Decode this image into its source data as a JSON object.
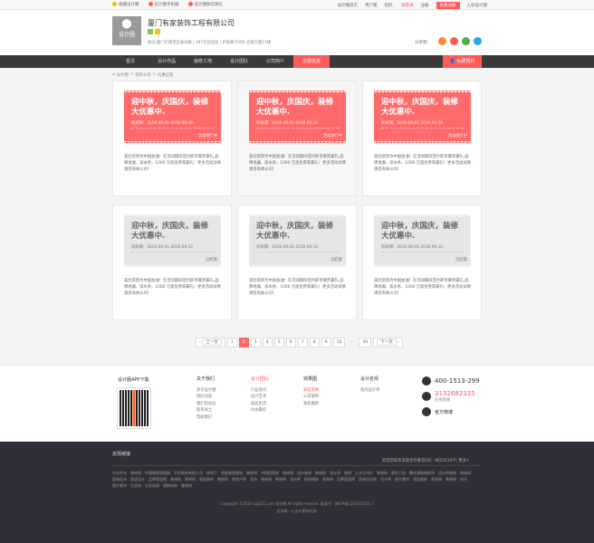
{
  "topbar": {
    "left": [
      "收藏设计圈",
      "设计圈手机端",
      "设计圈微信微信"
    ],
    "right": [
      "设计圈首页",
      "用户版",
      "您好,",
      "请登录",
      "注册",
      "免费注册",
      "入驻设计圈"
    ]
  },
  "header": {
    "logo_text": "设计圈",
    "company": "厦门有家装饰工程有限公司",
    "address": "地址:厦门市湖里区泰达路 | 397号创业园 | 护安路719号 名家大厦11楼",
    "share_label": "分享到:"
  },
  "nav": {
    "items": [
      "首页",
      "设计作品",
      "装修工地",
      "设计团队",
      "公司简介",
      "优惠信息"
    ],
    "cta": "免费预约"
  },
  "breadcrumb": [
    "设计圈",
    ">",
    "装修公司",
    ">",
    "优惠信息"
  ],
  "coupons": [
    {
      "title": "迎中秋，庆国庆，装修大优惠中.",
      "date": "有效期：2016.09.01-2016.09.10",
      "status": "活动进行中",
      "desc": "美杜装饰为中国加油！在活动期间签约即享尊贵豪礼,品牌地漏、扣水条、1000 元现金券等豪礼！更多活动详情请咨询本公司！"
    },
    {
      "title": "迎中秋，庆国庆，装修大优惠中.",
      "date": "有效期：2016.09.01-2016.09.10",
      "status": "活动进行中",
      "desc": "美杜装饰为中国加油！在活动期间签约即享尊贵豪礼,品牌地漏、扣水条、1000 元现金券等豪礼！更多活动详情请咨询本公司！"
    },
    {
      "title": "迎中秋，庆国庆，装修大优惠中.",
      "date": "有效期：2016.09.01-2016.09.10",
      "status": "活动进行中",
      "desc": "美杜装饰为中国加油！在活动期间签约即享尊贵豪礼,品牌地漏、扣水条、1000 元现金券等豪礼！更多活动详情请咨询本公司！"
    },
    {
      "title": "迎中秋，庆国庆，装修大优惠中.",
      "date": "有效期：2016.09.01-2016.09.10",
      "status": "已结束",
      "desc": "美杜装饰为中国加油！在活动期间签约即享尊贵豪礼,品牌地漏、扣水条、1000 元现金券等豪礼！更多活动详情请咨询本公司！"
    },
    {
      "title": "迎中秋，庆国庆，装修大优惠中.",
      "date": "有效期：2016.09.01-2016.09.10",
      "status": "已结束",
      "desc": "美杜装饰为中国加油！在活动期间签约即享尊贵豪礼,品牌地漏、扣水条、1000 元现金券等豪礼！更多活动详情请咨询本公司！"
    },
    {
      "title": "迎中秋，庆国庆，装修大优惠中.",
      "date": "有效期：2016.09.01-2016.09.10",
      "status": "已结束",
      "desc": "美杜装饰为中国加油！在活动期间签约即享尊贵豪礼,品牌地漏、扣水条、1000 元现金券等豪礼！更多活动详情请咨询本公司！"
    }
  ],
  "pager": {
    "prev": "上一页",
    "pages": [
      "1",
      "2",
      "3",
      "4",
      "5",
      "6",
      "7",
      "8",
      "9",
      "10",
      "...",
      "30"
    ],
    "current": "2",
    "next": "下一页"
  },
  "footer": {
    "app_title": "设计圈APP下载",
    "col1": {
      "title": "关于我们",
      "items": [
        "关于设计圈",
        "团队风采",
        "我们的动态",
        "联系站士",
        "帮助我们"
      ]
    },
    "col2": {
      "title": "设计团队",
      "items": [
        "行业资讯",
        "设计艺术",
        "家居生活",
        "风水篇论"
      ]
    },
    "col3": {
      "title": "效果图",
      "items": [
        "家装案例",
        "公装案例",
        "家居图库"
      ]
    },
    "col4": {
      "title": "设计名师",
      "items": [
        "室内设计师"
      ]
    },
    "phone1": "400-1513-299",
    "phone2": "3132682335",
    "phone2_sub": "在线客服",
    "weibo": "官方微博"
  },
  "bottom": {
    "links_title": "友情链接",
    "links_right": "欢迎您联系友链合作事宜QQ：865451971    更多+",
    "links": [
      "众包平台",
      "装修网",
      "中国建材采购网",
      "大宅装饰有限公司",
      "房地产",
      "房屋装修建材",
      "装修网",
      "中国招投网",
      "装修网",
      "设计装饰",
      "装修网",
      "设计网",
      "装修",
      "上木工作台",
      "装修网",
      "家纺卫浴",
      "整木建筑装饰网",
      "设计师装修",
      "装饰网",
      "家装设计",
      "家居设计",
      "品牌家居网",
      "装修网",
      "钢琴网",
      "家居装饰",
      "装修网",
      "房地产网",
      "家纺",
      "装修网",
      "装修网",
      "设计师",
      "网站模板",
      "家装网",
      "品牌家居网",
      "家装设计网",
      "设计师",
      "图片素材",
      "家居装饰",
      "家装网",
      "装修网",
      "设计",
      "图片素材",
      "企业站",
      "企业站网",
      "建筑材料",
      "装修网"
    ],
    "copyright1": "Copyright ©2016 sjq315.com 设计圈 All rights reserve. 备案号：闽ICP备12016225号-2",
    "copyright2": "设计圈 - 让设计更有价值!"
  }
}
